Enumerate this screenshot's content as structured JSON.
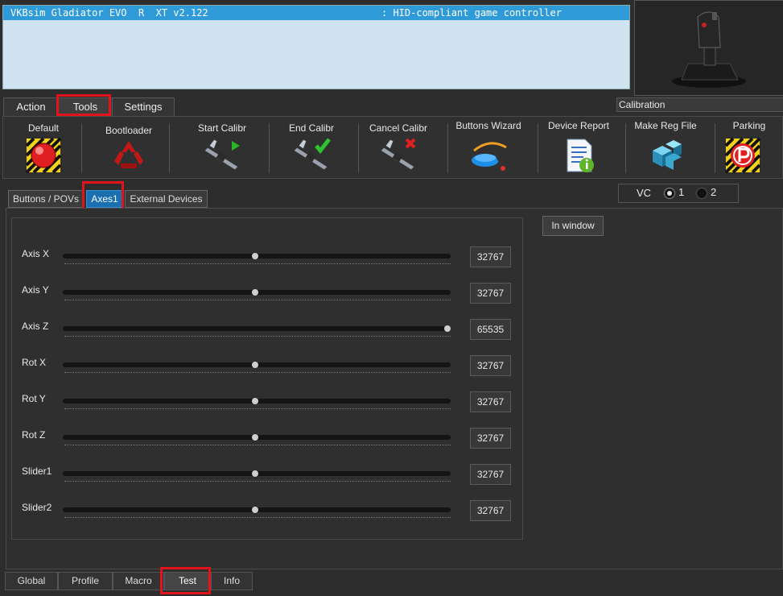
{
  "device": {
    "name": "VKBsim Gladiator EVO  R  XT v2.122",
    "type": ": HID-compliant game controller"
  },
  "top_tabs": [
    "Action",
    "Tools",
    "Settings"
  ],
  "calibration_label": "Calibration",
  "toolbar": {
    "default": "Default",
    "bootloader": "Bootloader",
    "start_calibr": "Start Calibr",
    "end_calibr": "End Calibr",
    "cancel_calibr": "Cancel Calibr",
    "buttons_wizard": "Buttons Wizard",
    "device_report": "Device Report",
    "make_reg_file": "Make Reg File",
    "parking": "Parking"
  },
  "sub_tabs": [
    "Buttons / POVs",
    "Axes1",
    "External Devices"
  ],
  "vc": {
    "label": "VC",
    "option1": "1",
    "option2": "2",
    "selected": "1"
  },
  "in_window_label": "In window",
  "axes": [
    {
      "label": "Axis X",
      "value": "32767",
      "fraction": 0.5
    },
    {
      "label": "Axis Y",
      "value": "32767",
      "fraction": 0.5
    },
    {
      "label": "Axis Z",
      "value": "65535",
      "fraction": 1.0
    },
    {
      "label": "Rot X",
      "value": "32767",
      "fraction": 0.5
    },
    {
      "label": "Rot Y",
      "value": "32767",
      "fraction": 0.5
    },
    {
      "label": "Rot Z",
      "value": "32767",
      "fraction": 0.5
    },
    {
      "label": "Slider1",
      "value": "32767",
      "fraction": 0.5
    },
    {
      "label": "Slider2",
      "value": "32767",
      "fraction": 0.5
    }
  ],
  "bottom_tabs": [
    "Global",
    "Profile",
    "Macro",
    "Test",
    "Info"
  ],
  "colors": {
    "highlight": "#e1141b",
    "selected_row": "#2e9ad8",
    "active_subtab": "#1a6fb0"
  }
}
